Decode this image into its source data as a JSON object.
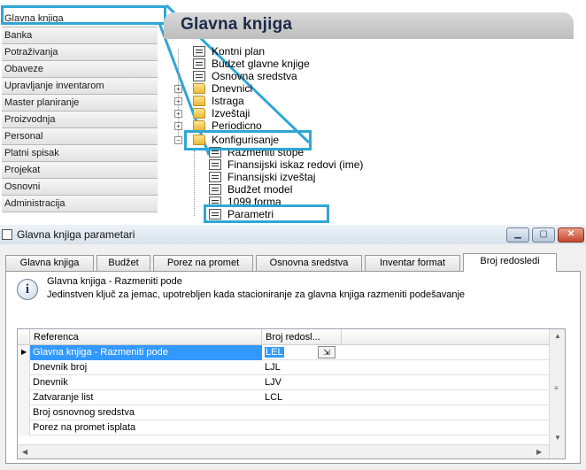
{
  "sidebar": {
    "items": [
      {
        "label": "Glavna knjiga"
      },
      {
        "label": "Banka"
      },
      {
        "label": "Potraživanja"
      },
      {
        "label": "Obaveze"
      },
      {
        "label": "Upravljanje inventarom"
      },
      {
        "label": "Master planiranje"
      },
      {
        "label": "Proizvodnja"
      },
      {
        "label": "Personal"
      },
      {
        "label": "Platni spisak"
      },
      {
        "label": "Projekat"
      },
      {
        "label": "Osnovni"
      },
      {
        "label": "Administracija"
      }
    ]
  },
  "module": {
    "title": "Glavna knjiga"
  },
  "tree": {
    "nodes": [
      {
        "label": "Kontni plan",
        "icon": "document-icon"
      },
      {
        "label": "Budzet glavne knjige",
        "icon": "document-icon"
      },
      {
        "label": "Osnovna sredstva",
        "icon": "document-icon"
      },
      {
        "label": "Dnevnici",
        "icon": "folder-icon"
      },
      {
        "label": "Istraga",
        "icon": "folder-icon"
      },
      {
        "label": "Izveštaji",
        "icon": "folder-icon"
      },
      {
        "label": "Periodicno",
        "icon": "folder-icon"
      },
      {
        "label": "Konfigurisanje",
        "icon": "folder-icon"
      },
      {
        "label": "Razmeniti stope",
        "icon": "document-icon"
      },
      {
        "label": "Finansijski iskaz redovi (ime)",
        "icon": "document-icon"
      },
      {
        "label": "Finansijski izveštaj",
        "icon": "document-icon"
      },
      {
        "label": "Budžet model",
        "icon": "document-icon"
      },
      {
        "label": "1099 forma",
        "icon": "document-icon"
      },
      {
        "label": "Parametri",
        "icon": "document-icon"
      }
    ]
  },
  "dialog": {
    "title": "Glavna knjiga parametari",
    "tabs": [
      {
        "label": "Glavna knjiga"
      },
      {
        "label": "Budžet"
      },
      {
        "label": "Porez na promet"
      },
      {
        "label": "Osnovna sredstva"
      },
      {
        "label": "Inventar format"
      },
      {
        "label": "Broj redosledi"
      }
    ],
    "active_tab": "Broj redosledi",
    "info": {
      "title": "Glavna knjiga - Razmeniti pode",
      "description": "Jedinstven ključ za jemac, upotrebljen kada stacioniranje za glavna knjiga razmeniti podešavanje"
    },
    "grid": {
      "columns": [
        "Referenca",
        "Broj redosl..."
      ],
      "rows": [
        {
          "reference": "Glavna knjiga - Razmeniti pode",
          "sequence": "LEL",
          "current": true
        },
        {
          "reference": "Dnevnik broj",
          "sequence": "LJL",
          "current": false
        },
        {
          "reference": "Dnevnik",
          "sequence": "LJV",
          "current": false
        },
        {
          "reference": "Zatvaranje list",
          "sequence": "LCL",
          "current": false
        },
        {
          "reference": "Broj osnovnog sredstva",
          "sequence": "",
          "current": false
        },
        {
          "reference": "Porez na promet isplata",
          "sequence": "",
          "current": false
        }
      ]
    }
  },
  "colors": {
    "callout": "#2fa6d6",
    "selection": "#3399ff",
    "header": "#c8c8c8"
  }
}
